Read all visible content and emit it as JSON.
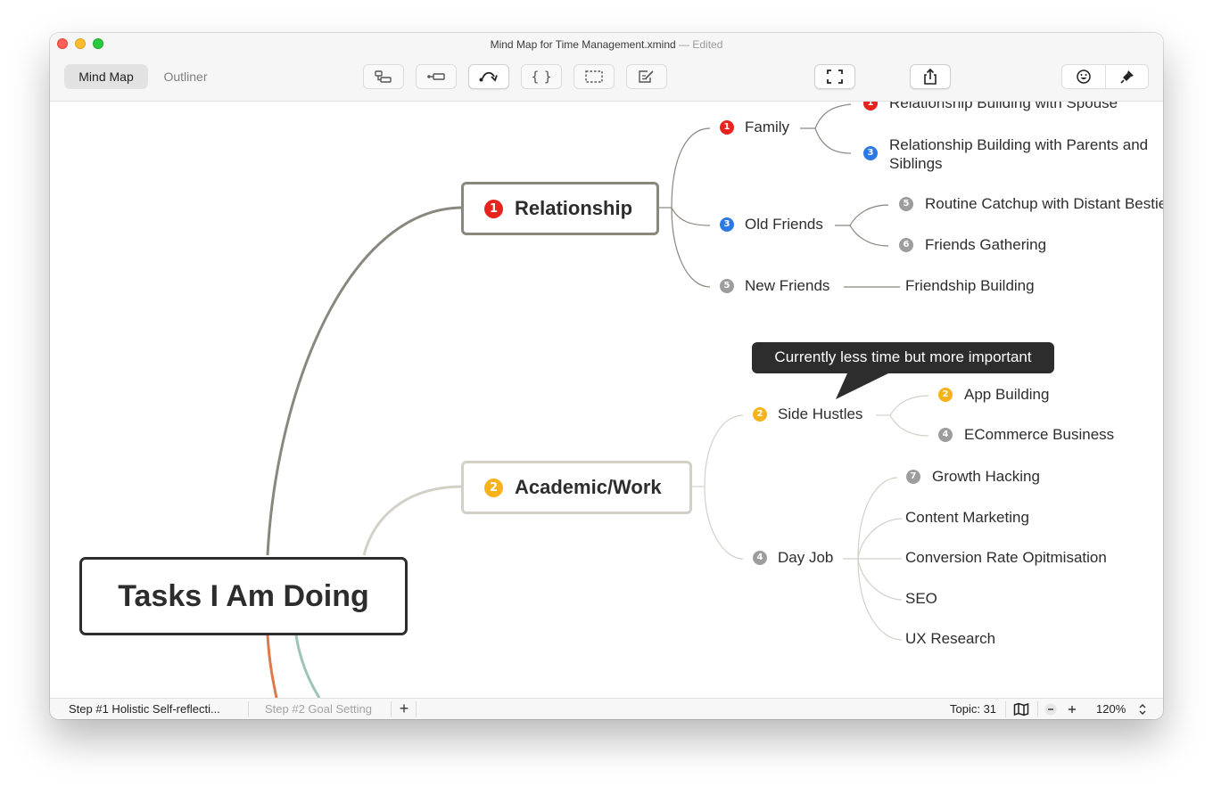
{
  "window": {
    "title": "Mind Map for Time Management.xmind",
    "status": "— Edited"
  },
  "view_switch": {
    "mind_map": "Mind Map",
    "outliner": "Outliner"
  },
  "toolbar": {
    "buttons": [
      "subtopic-icon",
      "topic-icon",
      "relationship-icon",
      "boundary-icon",
      "summary-icon",
      "note-icon",
      "fullscreen-icon",
      "share-icon",
      "emoji-icon",
      "format-brush-icon"
    ]
  },
  "map": {
    "central_topic": "Tasks I Am Doing",
    "branches": [
      {
        "label": "Relationship",
        "marker": "1",
        "subtopics": [
          {
            "label": "Family",
            "marker": "1",
            "children": [
              {
                "label": "Relationship Building with Spouse",
                "marker": "1"
              },
              {
                "label": "Relationship Building with Parents and Siblings",
                "marker": "3"
              }
            ]
          },
          {
            "label": "Old Friends",
            "marker": "3",
            "children": [
              {
                "label": "Routine Catchup with Distant Besties",
                "marker": "5"
              },
              {
                "label": "Friends Gathering",
                "marker": "6"
              }
            ]
          },
          {
            "label": "New Friends",
            "marker": "5",
            "children": [
              {
                "label": "Friendship Building"
              }
            ]
          }
        ]
      },
      {
        "label": "Academic/Work",
        "marker": "2",
        "subtopics": [
          {
            "label": "Side Hustles",
            "marker": "2",
            "callout": "Currently less time but more important",
            "children": [
              {
                "label": "App Building",
                "marker": "2"
              },
              {
                "label": "ECommerce Business",
                "marker": "4"
              }
            ]
          },
          {
            "label": "Day Job",
            "marker": "4",
            "children": [
              {
                "label": "Growth Hacking",
                "marker": "7"
              },
              {
                "label": "Content Marketing"
              },
              {
                "label": "Conversion Rate Opitmisation"
              },
              {
                "label": "SEO"
              },
              {
                "label": "UX Research"
              }
            ]
          }
        ]
      }
    ]
  },
  "colors": {
    "priority_1": "#e8231f",
    "priority_2": "#f6b21b",
    "priority_3": "#2a79e4",
    "priority_other": "#9d9d9d",
    "branch_relationship": "#8a877e",
    "branch_work": "#d3d0c7",
    "branch_orange": "#e0794a",
    "branch_teal": "#9cc5b8"
  },
  "status": {
    "sheets": [
      "Step #1 Holistic Self-reflecti...",
      "Step #2 Goal Setting"
    ],
    "add_sheet": "+",
    "topic_count": "Topic: 31",
    "zoom": "120%"
  }
}
